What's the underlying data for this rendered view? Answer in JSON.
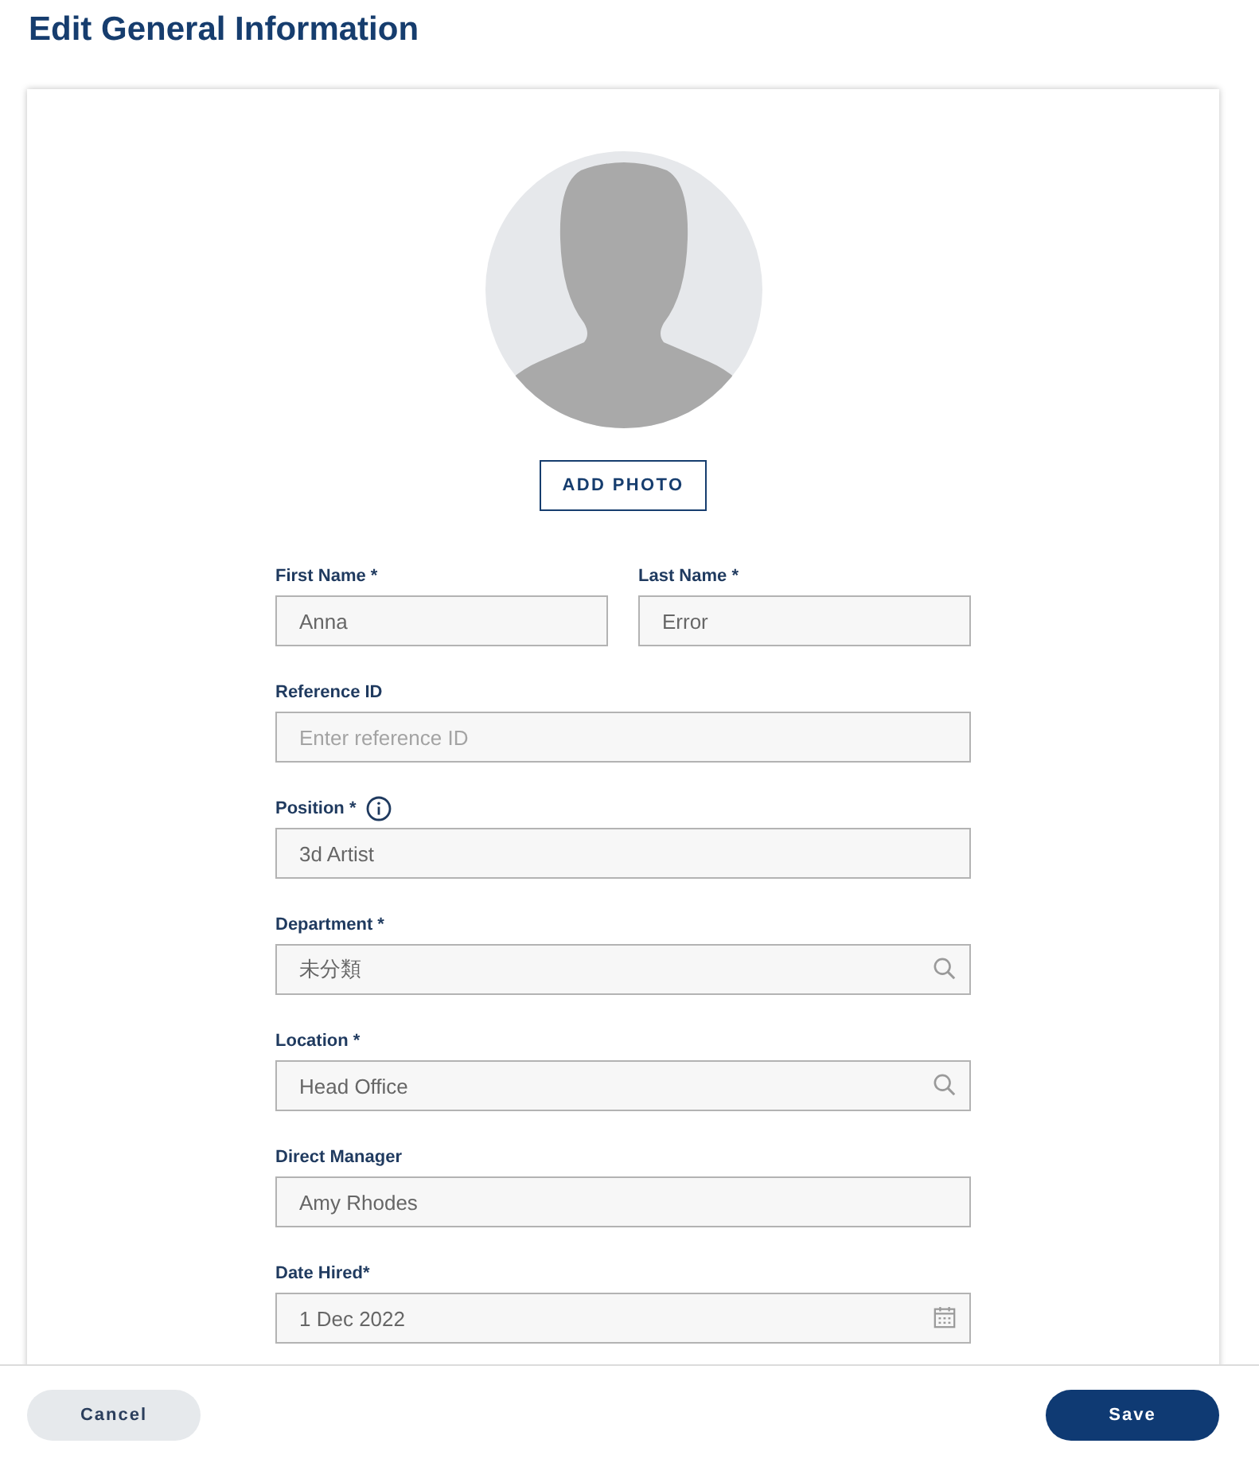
{
  "title": "Edit General Information",
  "photo": {
    "kind": "avatar"
  },
  "add_photo_button": "ADD PHOTO",
  "rows": [
    [
      {
        "label": "First Name *",
        "value": "Anna",
        "kind": "text"
      },
      {
        "label": "Last Name *",
        "value": "Error",
        "kind": "text"
      }
    ],
    [
      {
        "label": "Reference ID",
        "placeholder": "Enter reference ID",
        "kind": "text"
      }
    ],
    [
      {
        "label": "Position *",
        "value": "3d Artist",
        "kind": "text",
        "info": true
      }
    ],
    [
      {
        "label": "Department *",
        "value": "未分類",
        "kind": "search"
      }
    ],
    [
      {
        "label": "Location *",
        "value": "Head Office",
        "kind": "search"
      }
    ],
    [
      {
        "label": "Direct Manager",
        "value": "Amy Rhodes",
        "kind": "text"
      }
    ],
    [
      {
        "label": "Date Hired*",
        "value": "1 Dec 2022",
        "kind": "date"
      }
    ]
  ],
  "footer": {
    "cancel": "Cancel",
    "save": "Save"
  }
}
